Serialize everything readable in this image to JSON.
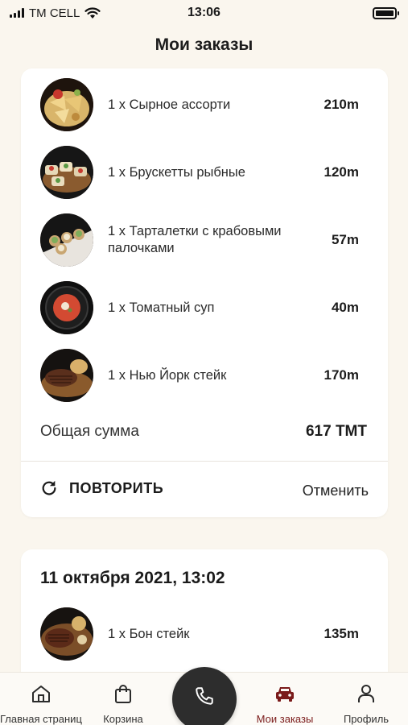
{
  "status_bar": {
    "carrier": "TM CELL",
    "time": "13:06"
  },
  "page": {
    "title": "Мои заказы"
  },
  "orders": [
    {
      "items": [
        {
          "name": "1 x Сырное ассорти",
          "price": "210m",
          "image": "cheese-platter-photo"
        },
        {
          "name": "1 x Брускетты рыбные",
          "price": "120m",
          "image": "bruschetta-photo"
        },
        {
          "name": "1 x Тарталетки с крабовыми палочками",
          "price": "57m",
          "image": "tartlets-photo"
        },
        {
          "name": "1 x Томатный суп",
          "price": "40m",
          "image": "tomato-soup-photo"
        },
        {
          "name": "1 x Нью Йорк стейк",
          "price": "170m",
          "image": "steak-photo"
        }
      ],
      "total_label": "Общая сумма",
      "total_value": "617 TMT",
      "repeat_label": "ПОВТОРИТЬ",
      "cancel_label": "Отменить"
    },
    {
      "date": "11 октября 2021, 13:02",
      "items": [
        {
          "name": "1 x Бон стейк",
          "price": "135m",
          "image": "bone-steak-photo"
        }
      ]
    }
  ],
  "tab_bar": {
    "tabs": [
      {
        "label": "Главная страница",
        "icon": "home-icon"
      },
      {
        "label": "Корзина",
        "icon": "shopping-bag-icon"
      },
      {
        "label": "Мои заказы",
        "icon": "car-icon",
        "active": true
      },
      {
        "label": "Профиль",
        "icon": "user-icon"
      }
    ],
    "call_icon": "phone-icon"
  },
  "colors": {
    "background": "#faf6ee",
    "card": "#ffffff",
    "accent": "#7a1a1a",
    "fab": "#2d2d2d"
  }
}
